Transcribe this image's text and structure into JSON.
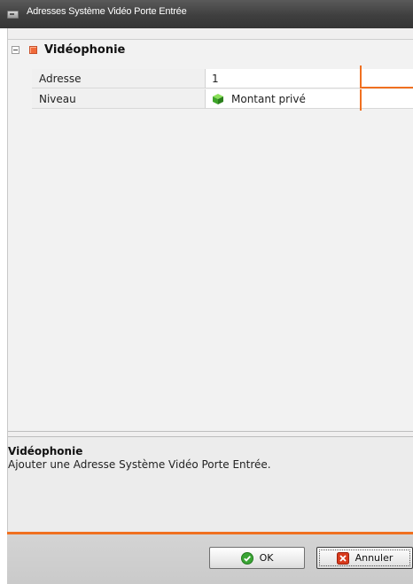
{
  "window": {
    "title": "Adresses Système Vidéo Porte Entrée"
  },
  "property_grid": {
    "group": {
      "label": "Vidéophonie",
      "expanded": true,
      "icon": "category-square-icon"
    },
    "rows": [
      {
        "name": "Adresse",
        "value": "1",
        "icon": ""
      },
      {
        "name": "Niveau",
        "value": "Montant privé",
        "icon": "green-cube-icon"
      }
    ]
  },
  "description": {
    "title": "Vidéophonie",
    "text": "Ajouter une Adresse Système Vidéo Porte Entrée."
  },
  "footer": {
    "ok_label": "OK",
    "cancel_label": "Annuler"
  },
  "colors": {
    "accent": "#f07020",
    "titlebar": "#3f3f3f",
    "ok_icon": "#3aa535",
    "cancel_icon": "#d83a1c"
  }
}
